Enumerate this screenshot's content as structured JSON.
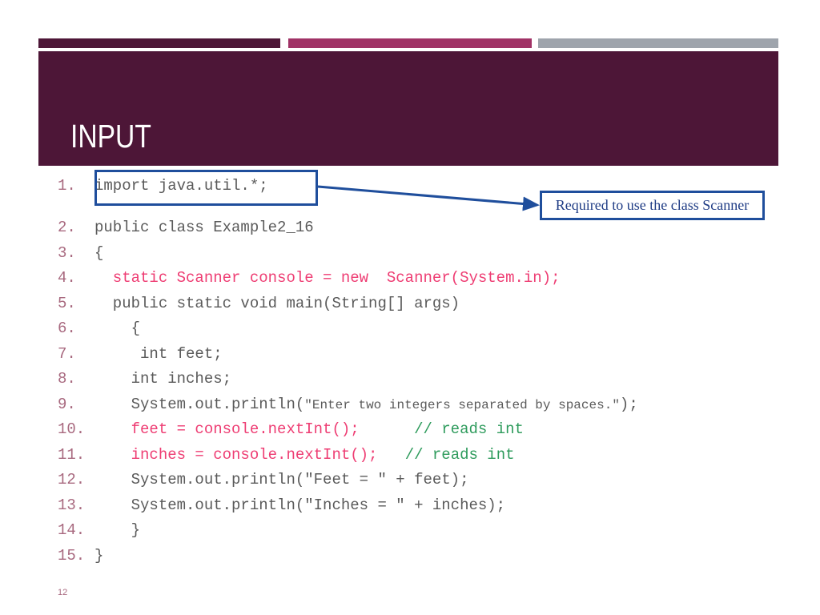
{
  "slide": {
    "title": "INPUT",
    "page_number": "12"
  },
  "theme": {
    "banner_color": "#4D1637",
    "accent_color": "#A03266",
    "gray_color": "#9EA4AC",
    "callout_border_color": "#1F4E9C",
    "callout_text_color": "#1F3C85",
    "code_color": "#5A5A5A",
    "code_highlight_color": "#EE3D73",
    "comment_color": "#2E9B5C",
    "lineno_color": "#A8697F"
  },
  "topbars": [
    {
      "name": "dark-bar",
      "color": "#4D1637"
    },
    {
      "name": "accent-bar",
      "color": "#A03266"
    },
    {
      "name": "gray-bar",
      "color": "#9EA4AC"
    }
  ],
  "code": {
    "language": "java",
    "lines": [
      {
        "n": "1.",
        "text": "import java.util.*;"
      },
      {
        "n": "2.",
        "text": "public class Example2_16"
      },
      {
        "n": "3.",
        "text": "{"
      },
      {
        "n": "4.",
        "text": "   static Scanner console = new  Scanner(System.in);"
      },
      {
        "n": "5.",
        "text": "   public static void main(String[] args)"
      },
      {
        "n": "6.",
        "text": "     {"
      },
      {
        "n": "7.",
        "text": "      int feet;"
      },
      {
        "n": "8.",
        "text": "     int inches;"
      },
      {
        "n": "9.",
        "text": "     System.out.println(\"Enter two integers separated by spaces.\");"
      },
      {
        "n": "10.",
        "text": "     feet = console.nextInt();      // reads int"
      },
      {
        "n": "11.",
        "text": "     inches = console.nextInt();   // reads int"
      },
      {
        "n": "12.",
        "text": "     System.out.println(\"Feet = \" + feet);"
      },
      {
        "n": "13.",
        "text": "     System.out.println(\"Inches = \" + inches);"
      },
      {
        "n": "14.",
        "text": "     }"
      },
      {
        "n": "15.",
        "text": "}"
      }
    ],
    "segments": {
      "l1": [
        {
          "t": "import java.util.*;",
          "c": ""
        }
      ],
      "l2": [
        {
          "t": "public class Example2_16",
          "c": ""
        }
      ],
      "l3": [
        {
          "t": "{",
          "c": ""
        }
      ],
      "l4": [
        {
          "t": "  static Scanner console = new  Scanner(System.in);",
          "c": "pink"
        }
      ],
      "l5": [
        {
          "t": "  public static void main(String[] args)",
          "c": ""
        }
      ],
      "l6": [
        {
          "t": "    {",
          "c": ""
        }
      ],
      "l7": [
        {
          "t": "     int feet;",
          "c": ""
        }
      ],
      "l8": [
        {
          "t": "    int inches;",
          "c": ""
        }
      ],
      "l9": [
        {
          "t": "    System.out.println(",
          "c": ""
        },
        {
          "t": "\"Enter two integers separated by spaces.\"",
          "c": "small"
        },
        {
          "t": ");",
          "c": ""
        }
      ],
      "l10": [
        {
          "t": "    feet = console.nextInt();",
          "c": "pink"
        },
        {
          "t": "      ",
          "c": ""
        },
        {
          "t": "// reads int",
          "c": "green"
        }
      ],
      "l11": [
        {
          "t": "    inches = console.nextInt();",
          "c": "pink"
        },
        {
          "t": "   ",
          "c": ""
        },
        {
          "t": "// reads int",
          "c": "green"
        }
      ],
      "l12": [
        {
          "t": "    System.out.println(\"Feet = \" + feet);",
          "c": ""
        }
      ],
      "l13": [
        {
          "t": "    System.out.println(\"Inches = \" + inches);",
          "c": ""
        }
      ],
      "l14": [
        {
          "t": "    }",
          "c": ""
        }
      ],
      "l15": [
        {
          "t": "}",
          "c": ""
        }
      ]
    }
  },
  "callout": {
    "text": "Required to use the class Scanner"
  }
}
